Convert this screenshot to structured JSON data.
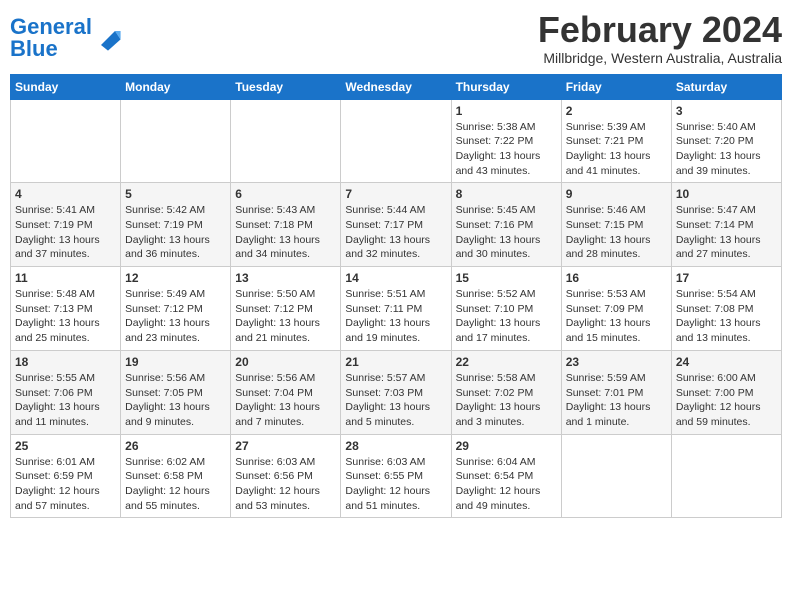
{
  "header": {
    "logo_text1": "General",
    "logo_text2": "Blue",
    "month": "February 2024",
    "location": "Millbridge, Western Australia, Australia"
  },
  "days_of_week": [
    "Sunday",
    "Monday",
    "Tuesday",
    "Wednesday",
    "Thursday",
    "Friday",
    "Saturday"
  ],
  "weeks": [
    [
      {
        "day": "",
        "detail": ""
      },
      {
        "day": "",
        "detail": ""
      },
      {
        "day": "",
        "detail": ""
      },
      {
        "day": "",
        "detail": ""
      },
      {
        "day": "1",
        "detail": "Sunrise: 5:38 AM\nSunset: 7:22 PM\nDaylight: 13 hours\nand 43 minutes."
      },
      {
        "day": "2",
        "detail": "Sunrise: 5:39 AM\nSunset: 7:21 PM\nDaylight: 13 hours\nand 41 minutes."
      },
      {
        "day": "3",
        "detail": "Sunrise: 5:40 AM\nSunset: 7:20 PM\nDaylight: 13 hours\nand 39 minutes."
      }
    ],
    [
      {
        "day": "4",
        "detail": "Sunrise: 5:41 AM\nSunset: 7:19 PM\nDaylight: 13 hours\nand 37 minutes."
      },
      {
        "day": "5",
        "detail": "Sunrise: 5:42 AM\nSunset: 7:19 PM\nDaylight: 13 hours\nand 36 minutes."
      },
      {
        "day": "6",
        "detail": "Sunrise: 5:43 AM\nSunset: 7:18 PM\nDaylight: 13 hours\nand 34 minutes."
      },
      {
        "day": "7",
        "detail": "Sunrise: 5:44 AM\nSunset: 7:17 PM\nDaylight: 13 hours\nand 32 minutes."
      },
      {
        "day": "8",
        "detail": "Sunrise: 5:45 AM\nSunset: 7:16 PM\nDaylight: 13 hours\nand 30 minutes."
      },
      {
        "day": "9",
        "detail": "Sunrise: 5:46 AM\nSunset: 7:15 PM\nDaylight: 13 hours\nand 28 minutes."
      },
      {
        "day": "10",
        "detail": "Sunrise: 5:47 AM\nSunset: 7:14 PM\nDaylight: 13 hours\nand 27 minutes."
      }
    ],
    [
      {
        "day": "11",
        "detail": "Sunrise: 5:48 AM\nSunset: 7:13 PM\nDaylight: 13 hours\nand 25 minutes."
      },
      {
        "day": "12",
        "detail": "Sunrise: 5:49 AM\nSunset: 7:12 PM\nDaylight: 13 hours\nand 23 minutes."
      },
      {
        "day": "13",
        "detail": "Sunrise: 5:50 AM\nSunset: 7:12 PM\nDaylight: 13 hours\nand 21 minutes."
      },
      {
        "day": "14",
        "detail": "Sunrise: 5:51 AM\nSunset: 7:11 PM\nDaylight: 13 hours\nand 19 minutes."
      },
      {
        "day": "15",
        "detail": "Sunrise: 5:52 AM\nSunset: 7:10 PM\nDaylight: 13 hours\nand 17 minutes."
      },
      {
        "day": "16",
        "detail": "Sunrise: 5:53 AM\nSunset: 7:09 PM\nDaylight: 13 hours\nand 15 minutes."
      },
      {
        "day": "17",
        "detail": "Sunrise: 5:54 AM\nSunset: 7:08 PM\nDaylight: 13 hours\nand 13 minutes."
      }
    ],
    [
      {
        "day": "18",
        "detail": "Sunrise: 5:55 AM\nSunset: 7:06 PM\nDaylight: 13 hours\nand 11 minutes."
      },
      {
        "day": "19",
        "detail": "Sunrise: 5:56 AM\nSunset: 7:05 PM\nDaylight: 13 hours\nand 9 minutes."
      },
      {
        "day": "20",
        "detail": "Sunrise: 5:56 AM\nSunset: 7:04 PM\nDaylight: 13 hours\nand 7 minutes."
      },
      {
        "day": "21",
        "detail": "Sunrise: 5:57 AM\nSunset: 7:03 PM\nDaylight: 13 hours\nand 5 minutes."
      },
      {
        "day": "22",
        "detail": "Sunrise: 5:58 AM\nSunset: 7:02 PM\nDaylight: 13 hours\nand 3 minutes."
      },
      {
        "day": "23",
        "detail": "Sunrise: 5:59 AM\nSunset: 7:01 PM\nDaylight: 13 hours\nand 1 minute."
      },
      {
        "day": "24",
        "detail": "Sunrise: 6:00 AM\nSunset: 7:00 PM\nDaylight: 12 hours\nand 59 minutes."
      }
    ],
    [
      {
        "day": "25",
        "detail": "Sunrise: 6:01 AM\nSunset: 6:59 PM\nDaylight: 12 hours\nand 57 minutes."
      },
      {
        "day": "26",
        "detail": "Sunrise: 6:02 AM\nSunset: 6:58 PM\nDaylight: 12 hours\nand 55 minutes."
      },
      {
        "day": "27",
        "detail": "Sunrise: 6:03 AM\nSunset: 6:56 PM\nDaylight: 12 hours\nand 53 minutes."
      },
      {
        "day": "28",
        "detail": "Sunrise: 6:03 AM\nSunset: 6:55 PM\nDaylight: 12 hours\nand 51 minutes."
      },
      {
        "day": "29",
        "detail": "Sunrise: 6:04 AM\nSunset: 6:54 PM\nDaylight: 12 hours\nand 49 minutes."
      },
      {
        "day": "",
        "detail": ""
      },
      {
        "day": "",
        "detail": ""
      }
    ]
  ]
}
